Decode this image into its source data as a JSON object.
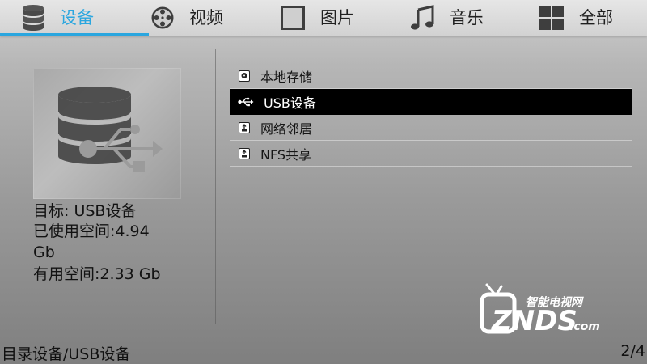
{
  "tabs": [
    {
      "label": "设备",
      "icon": "database-icon",
      "active": true
    },
    {
      "label": "视频",
      "icon": "film-reel-icon",
      "active": false
    },
    {
      "label": "图片",
      "icon": "picture-frame-icon",
      "active": false
    },
    {
      "label": "音乐",
      "icon": "music-note-icon",
      "active": false
    },
    {
      "label": "全部",
      "icon": "grid-icon",
      "active": false
    }
  ],
  "info": {
    "target": "目标: USB设备",
    "used_line1": "已使用空间:4.94",
    "used_line2": "Gb",
    "free": "有用空间:2.33 Gb"
  },
  "list": [
    {
      "label": "本地存储",
      "icon": "disk-icon",
      "selected": false
    },
    {
      "label": "USB设备",
      "icon": "usb-icon",
      "selected": true
    },
    {
      "label": "网络邻居",
      "icon": "network-share-icon",
      "selected": false
    },
    {
      "label": "NFS共享",
      "icon": "network-share-icon",
      "selected": false
    }
  ],
  "footer": {
    "path": "目录设备/USB设备",
    "page": "2/4"
  },
  "watermark": {
    "tagline": "智能电视网",
    "brand": "ZNDS",
    "suffix": ".com"
  },
  "colors": {
    "accent": "#2aa6df",
    "selected_bg": "#000000"
  }
}
